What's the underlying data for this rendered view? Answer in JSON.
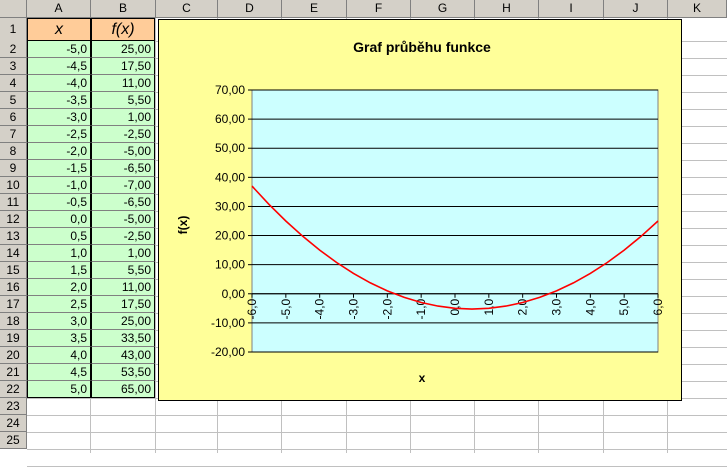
{
  "columns": [
    "A",
    "B",
    "C",
    "D",
    "E",
    "F",
    "G",
    "H",
    "I",
    "J",
    "K"
  ],
  "rows": [
    "1",
    "2",
    "3",
    "4",
    "5",
    "6",
    "7",
    "8",
    "9",
    "10",
    "11",
    "12",
    "13",
    "14",
    "15",
    "16",
    "17",
    "18",
    "19",
    "20",
    "21",
    "22",
    "23",
    "24",
    "25"
  ],
  "table": {
    "header_x": "x",
    "header_fx": "f(x)",
    "x_values": [
      "-5,0",
      "-4,5",
      "-4,0",
      "-3,5",
      "-3,0",
      "-2,5",
      "-2,0",
      "-1,5",
      "-1,0",
      "-0,5",
      "0,0",
      "0,5",
      "1,0",
      "1,5",
      "2,0",
      "2,5",
      "3,0",
      "3,5",
      "4,0",
      "4,5",
      "5,0"
    ],
    "fx_values": [
      "25,00",
      "17,50",
      "11,00",
      "5,50",
      "1,00",
      "-2,50",
      "-5,00",
      "-6,50",
      "-7,00",
      "-6,50",
      "-5,00",
      "-2,50",
      "1,00",
      "5,50",
      "11,00",
      "17,50",
      "25,00",
      "33,50",
      "43,00",
      "53,50",
      "65,00"
    ]
  },
  "colors": {
    "table_fill": "#ccffcc",
    "header_fill": "#ffcc99",
    "chart_bg": "#ffff99",
    "plot_bg": "#ccffff",
    "line": "#ff0000"
  },
  "chart_data": {
    "type": "line",
    "title": "Graf průběhu funkce",
    "xlabel": "x",
    "ylabel": "f(x)",
    "xlim": [
      -6,
      6
    ],
    "ylim": [
      -20,
      70
    ],
    "x_ticks": [
      "-6,0",
      "-5,0",
      "-4,0",
      "-3,0",
      "-2,0",
      "-1,0",
      "0,0",
      "1,0",
      "2,0",
      "3,0",
      "4,0",
      "5,0",
      "6,0"
    ],
    "y_ticks": [
      "70,00",
      "60,00",
      "50,00",
      "40,00",
      "30,00",
      "20,00",
      "10,00",
      "0,00",
      "-10,00",
      "-20,00"
    ],
    "grid": true,
    "legend": "none",
    "series": [
      {
        "x": [
          -6,
          -5.5,
          -5,
          -4.5,
          -4,
          -3.5,
          -3,
          -2.5,
          -2,
          -1.5,
          -1,
          -0.5,
          0,
          0.5,
          1,
          1.5,
          2,
          2.5,
          3,
          3.5,
          4,
          4.5,
          5,
          5.5,
          6
        ],
        "y": [
          37,
          30.75,
          25,
          19.75,
          15,
          10.75,
          7,
          3.75,
          1,
          -1.25,
          -3,
          -4.25,
          -5,
          -5.25,
          -5,
          -4.25,
          -3,
          -1.25,
          1,
          3.75,
          7,
          10.75,
          15,
          19.75,
          25
        ]
      }
    ]
  }
}
